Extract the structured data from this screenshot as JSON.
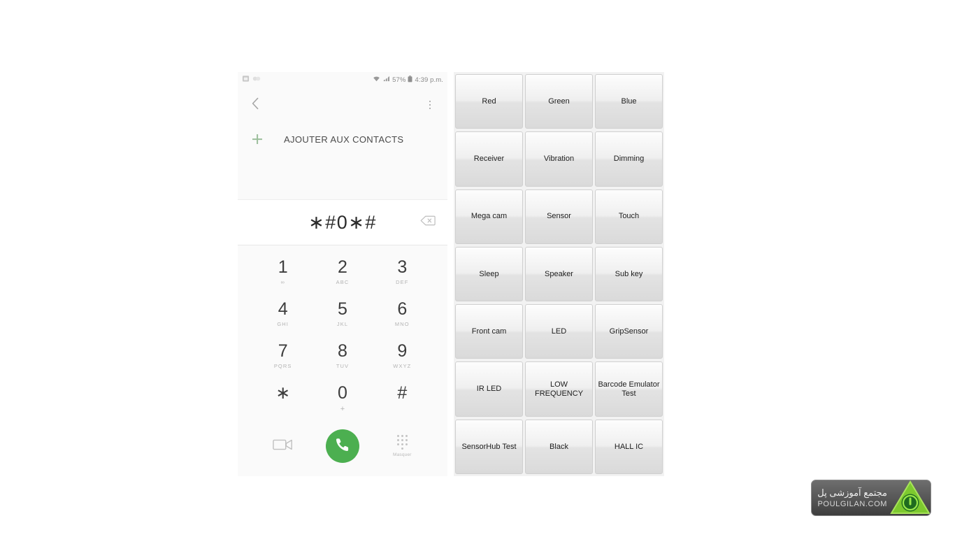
{
  "phone": {
    "status_bar": {
      "left_icons": [
        "sim-card-icon",
        "sync-icon"
      ],
      "wifi_icon": "wifi-icon",
      "signal_icon": "signal-bars-icon",
      "battery_percent": "57%",
      "battery_icon": "battery-icon",
      "clock": "4:39 p.m."
    },
    "action_bar": {
      "back_icon": "back-chevron-icon",
      "overflow_icon": "overflow-menu-icon"
    },
    "add_contacts": {
      "plus_icon": "plus-icon",
      "label": "AJOUTER AUX CONTACTS"
    },
    "display": {
      "dialed_number": "∗#0∗#",
      "backspace_icon": "backspace-icon"
    },
    "keypad": [
      {
        "digit": "1",
        "sub": "∞"
      },
      {
        "digit": "2",
        "sub": "ABC"
      },
      {
        "digit": "3",
        "sub": "DEF"
      },
      {
        "digit": "4",
        "sub": "GHI"
      },
      {
        "digit": "5",
        "sub": "JKL"
      },
      {
        "digit": "6",
        "sub": "MNO"
      },
      {
        "digit": "7",
        "sub": "PQRS"
      },
      {
        "digit": "8",
        "sub": "TUV"
      },
      {
        "digit": "9",
        "sub": "WXYZ"
      },
      {
        "digit": "∗",
        "sub": ""
      },
      {
        "digit": "0",
        "sub": "+"
      },
      {
        "digit": "#",
        "sub": ""
      }
    ],
    "bottom_bar": {
      "video_call_icon": "video-call-icon",
      "call_icon": "call-handset-icon",
      "keypad_icon": "keypad-dots-icon",
      "hide_label": "Masquer"
    },
    "colors": {
      "call_green": "#4caf50",
      "accent_plus": "#9cbf9c"
    }
  },
  "test_panel": {
    "buttons": [
      "Red",
      "Green",
      "Blue",
      "Receiver",
      "Vibration",
      "Dimming",
      "Mega cam",
      "Sensor",
      "Touch",
      "Sleep",
      "Speaker",
      "Sub key",
      "Front cam",
      "LED",
      "GripSensor",
      "IR LED",
      "LOW FREQUENCY",
      "Barcode Emulator Test",
      "SensorHub Test",
      "Black",
      "HALL IC"
    ],
    "background": "#f2f2f2"
  },
  "watermark": {
    "farsi": "مجتمع آموزشی پل",
    "english": "POULGILAN.COM",
    "icon": "power-triangle-icon",
    "icon_color": "#6ab82e"
  }
}
